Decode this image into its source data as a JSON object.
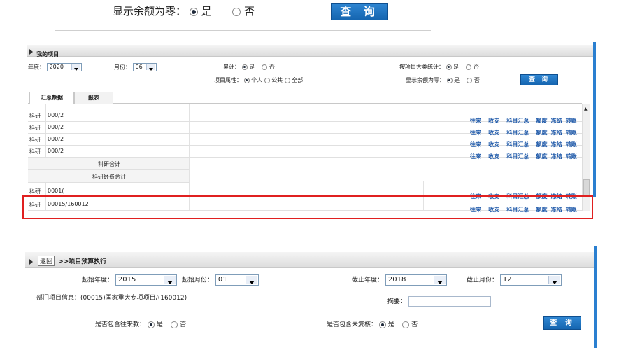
{
  "top": {
    "zero_balance_label": "显示余额为零：",
    "yes": "是",
    "no": "否",
    "query": "查 询"
  },
  "panel1": {
    "title": "我的项目",
    "year_label": "年度：",
    "year_value": "2020",
    "month_label": "月份：",
    "month_value": "06",
    "cumulative_label": "累计：",
    "cumulative_yes": "是",
    "cumulative_no": "否",
    "category_label": "按项目大类统计：",
    "category_yes": "是",
    "category_no": "否",
    "attr_label": "项目属性：",
    "attr_personal": "个人",
    "attr_public": "公共",
    "attr_all": "全部",
    "zero_label": "显示余额为零：",
    "zero_yes": "是",
    "zero_no": "否",
    "query": "查 询",
    "tabs": [
      "汇总数据",
      "报表"
    ],
    "rows": [
      {
        "type": "科研",
        "code": "000/2"
      },
      {
        "type": "科研",
        "code": "000/2"
      },
      {
        "type": "科研",
        "code": "000/2"
      },
      {
        "type": "科研",
        "code": "000/2"
      }
    ],
    "subtotal": "科研合计",
    "total": "科研经费总计",
    "row5": {
      "type": "科研",
      "code": "0001("
    },
    "row6": {
      "type": "科研",
      "code": "00015/160012"
    },
    "actions": [
      "往来",
      "收支",
      "科目汇总",
      "额度",
      "冻结",
      "转账"
    ]
  },
  "panel2": {
    "back": "返回",
    "title": ">>项目预算执行",
    "start_year_label": "起始年度：",
    "start_year": "2015",
    "start_month_label": "起始月份：",
    "start_month": "01",
    "end_year_label": "截止年度：",
    "end_year": "2018",
    "end_month_label": "截止月份：",
    "end_month": "12",
    "dept_info_label": "部门项目信息：",
    "dept_info_value": "(00015)国家重大专项项目/(160012)",
    "summary_label": "摘要：",
    "summary_value": "",
    "include_tx_label": "是否包含往来款：",
    "include_unreviewed_label": "是否包含未复核：",
    "yes": "是",
    "no": "否",
    "query": "查 询"
  },
  "colors": {
    "accent": "#1a6fc0",
    "highlight": "#e02020",
    "side": "#2a7fd0"
  }
}
